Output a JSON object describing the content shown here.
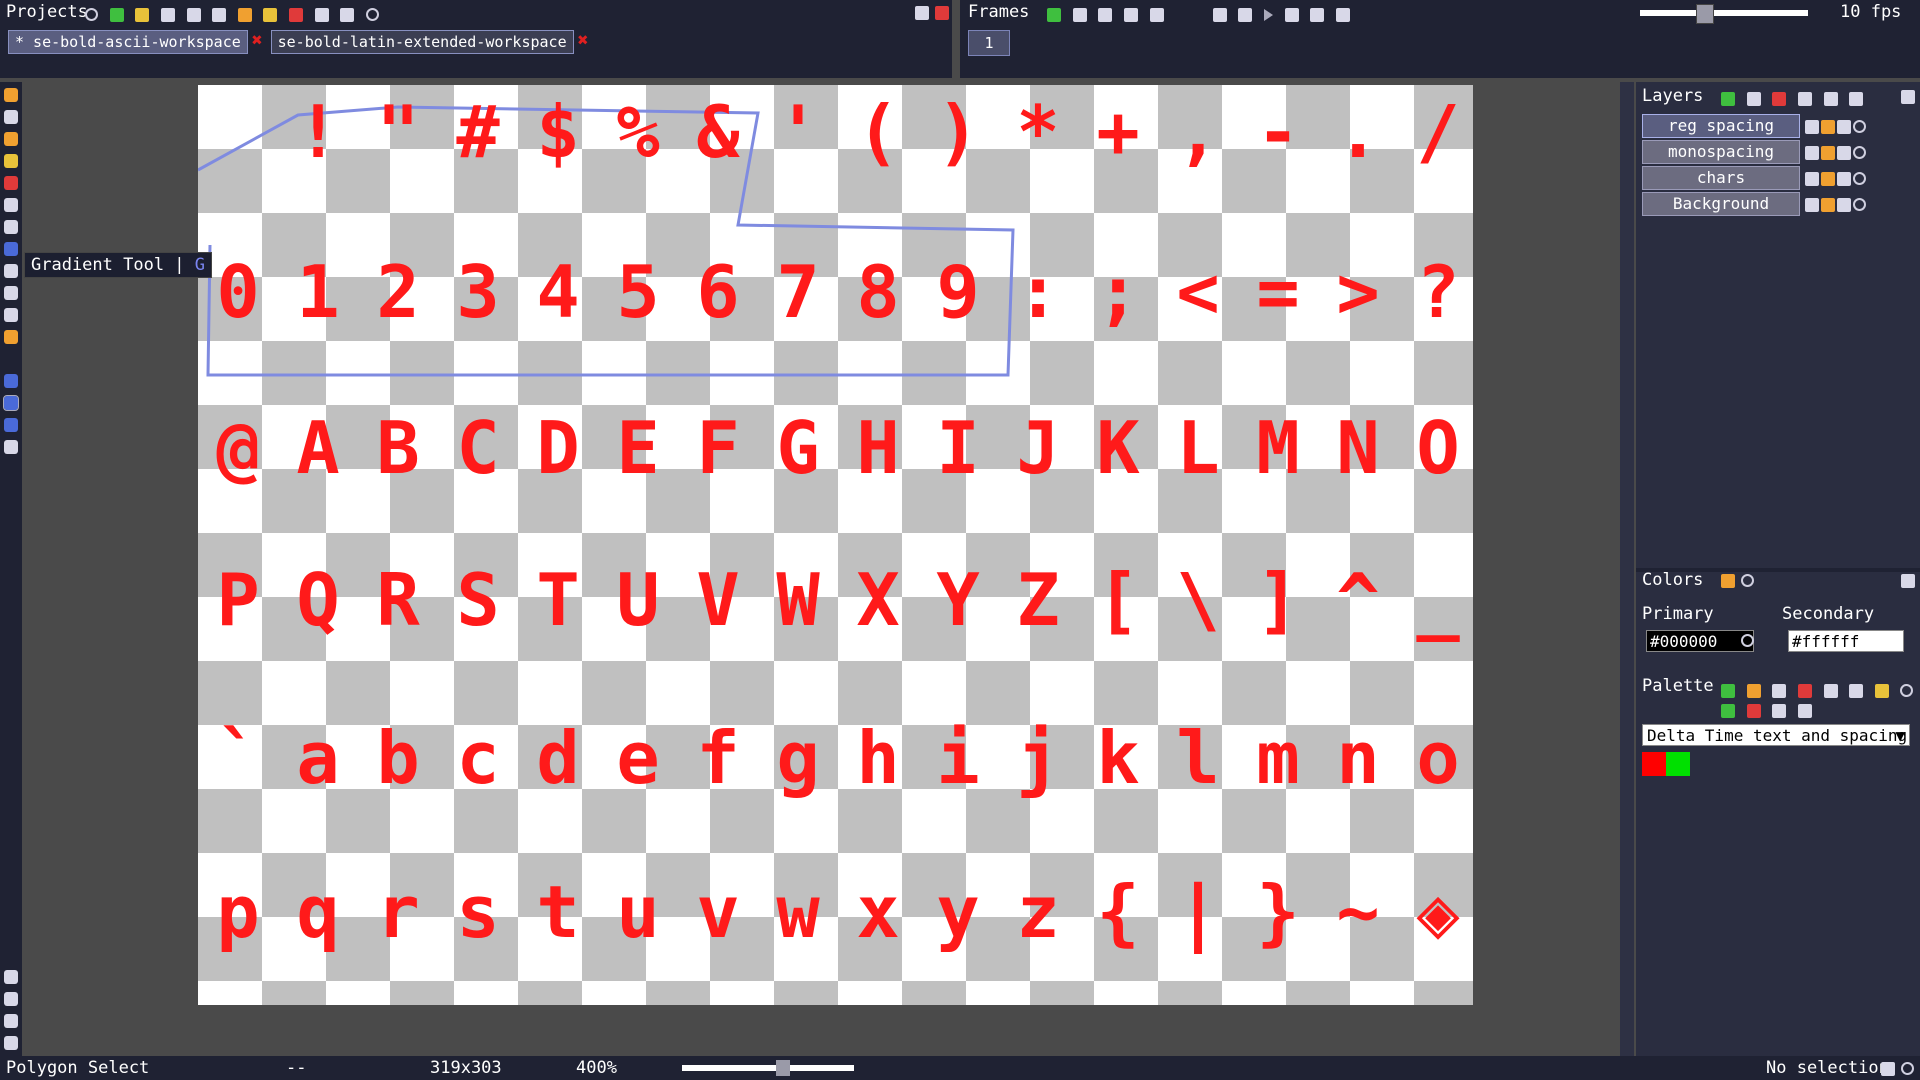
{
  "projects": {
    "title": "Projects",
    "tabs": [
      {
        "label": "* se-bold-ascii-workspace",
        "active": true
      },
      {
        "label": "se-bold-latin-extended-workspace",
        "active": false
      }
    ],
    "toolbar_icons": [
      "gear-icon",
      "add-icon",
      "import-icon",
      "save-icon",
      "save-as-icon",
      "export-icon",
      "center-icon",
      "image-icon",
      "reload-icon",
      "undo-icon",
      "redo-icon",
      "history-icon"
    ]
  },
  "frames": {
    "title": "Frames",
    "current_frame": "1",
    "fps_label": "10 fps",
    "fps_value": 10,
    "tool_icons": [
      "add-frame-icon",
      "copy-frame-icon",
      "delete-frame-icon",
      "link-icon",
      "onion-icon",
      "first-frame-icon",
      "prev-frame-icon",
      "play-icon",
      "next-frame-icon",
      "last-frame-icon",
      "loop-icon"
    ]
  },
  "tooltip": {
    "text": "Gradient Tool | ",
    "shortcut": "G"
  },
  "canvas": {
    "rows": [
      [
        "",
        "!",
        "\"",
        "#",
        "$",
        "%",
        "&",
        "'",
        "(",
        ")",
        "*",
        "+",
        ",",
        "-",
        ".",
        "/"
      ],
      [
        "0",
        "1",
        "2",
        "3",
        "4",
        "5",
        "6",
        "7",
        "8",
        "9",
        ":",
        ";",
        "<",
        "=",
        ">",
        "?"
      ],
      [
        "@",
        "A",
        "B",
        "C",
        "D",
        "E",
        "F",
        "G",
        "H",
        "I",
        "J",
        "K",
        "L",
        "M",
        "N",
        "O"
      ],
      [
        "P",
        "Q",
        "R",
        "S",
        "T",
        "U",
        "V",
        "W",
        "X",
        "Y",
        "Z",
        "[",
        "\\",
        "]",
        "^",
        "_"
      ],
      [
        "`",
        "a",
        "b",
        "c",
        "d",
        "e",
        "f",
        "g",
        "h",
        "i",
        "j",
        "k",
        "l",
        "m",
        "n",
        "o"
      ],
      [
        "p",
        "q",
        "r",
        "s",
        "t",
        "u",
        "v",
        "w",
        "x",
        "y",
        "z",
        "{",
        "|",
        "}",
        "~",
        "◈"
      ]
    ],
    "glyph_color": "#ff1a1a",
    "accent_color": "#00e000",
    "selection_color": "#7f8be0"
  },
  "layers": {
    "title": "Layers",
    "items": [
      {
        "name": "reg spacing",
        "active": true
      },
      {
        "name": "monospacing",
        "active": false
      },
      {
        "name": "chars",
        "active": false
      },
      {
        "name": "Background",
        "active": false
      }
    ]
  },
  "colors": {
    "title": "Colors",
    "primary_label": "Primary",
    "secondary_label": "Secondary",
    "primary_value": "#000000",
    "secondary_value": "#ffffff"
  },
  "palette": {
    "title": "Palette",
    "selected": "Delta Time text and spacing",
    "swatches": [
      "#ff0000",
      "#00e000"
    ]
  },
  "status": {
    "tool": "Polygon Select",
    "position": "--",
    "size": "319x303",
    "zoom": "400%",
    "zoom_value": 400,
    "selection": "No selection"
  }
}
